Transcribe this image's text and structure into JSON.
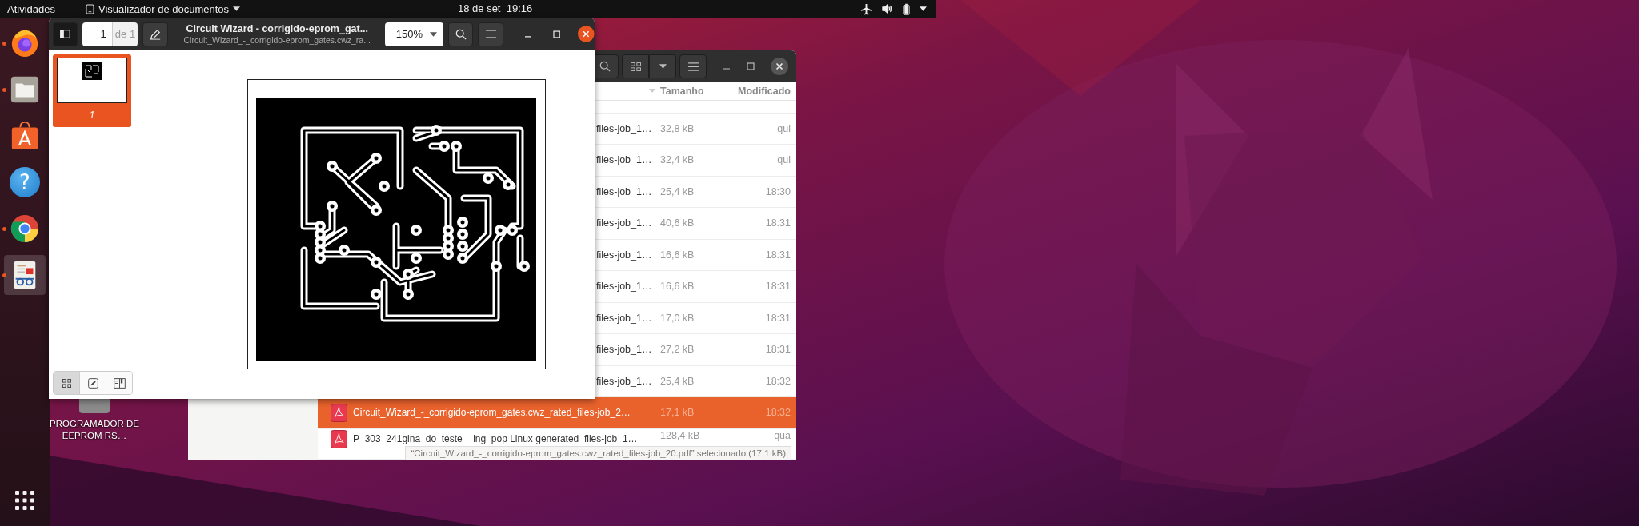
{
  "top_bar": {
    "activities": "Atividades",
    "app_menu": "Visualizador de documentos",
    "clock": "18 de set  19:16"
  },
  "dock": {
    "items": [
      {
        "kind": "firefox",
        "running": true,
        "selected": false
      },
      {
        "kind": "files",
        "running": true,
        "selected": false
      },
      {
        "kind": "software",
        "running": false,
        "selected": false
      },
      {
        "kind": "help",
        "running": false,
        "selected": false,
        "glyph": "?"
      },
      {
        "kind": "chrome",
        "running": true,
        "selected": false
      },
      {
        "kind": "viewer",
        "running": true,
        "selected": true
      }
    ]
  },
  "desktop_icons": [
    {
      "label": "PROGRAMADOR DE EEPROM RS…"
    }
  ],
  "document_viewer": {
    "page": "1",
    "page_total": "de 1",
    "title": "Circuit Wizard - corrigido-eprom_gat...",
    "subtitle": "Circuit_Wizard_-_corrigido-eprom_gates.cwz_ra...",
    "zoom": "150%",
    "thumbnails": [
      {
        "label": "1",
        "selected": true
      }
    ],
    "sidebar_tabs": [
      {
        "kind": "thumbnails",
        "selected": true
      },
      {
        "kind": "annotations",
        "selected": false
      },
      {
        "kind": "bookmarks",
        "selected": false
      }
    ]
  },
  "file_manager": {
    "columns": [
      "Tamanho",
      "Modificado"
    ],
    "rows": [
      {
        "kind": "covered",
        "name": "files-job_1…",
        "size": "32,8 kB",
        "modified": "qui",
        "selected": false
      },
      {
        "kind": "covered",
        "name": "files-job_1…",
        "size": "32,4 kB",
        "modified": "qui",
        "selected": false
      },
      {
        "kind": "covered",
        "name": "files-job_1…",
        "size": "25,4 kB",
        "modified": "18:30",
        "selected": false
      },
      {
        "kind": "covered",
        "name": "files-job_1…",
        "size": "40,6 kB",
        "modified": "18:31",
        "selected": false
      },
      {
        "kind": "covered",
        "name": "files-job_1…",
        "size": "16,6 kB",
        "modified": "18:31",
        "selected": false
      },
      {
        "kind": "covered",
        "name": "files-job_1…",
        "size": "16,6 kB",
        "modified": "18:31",
        "selected": false
      },
      {
        "kind": "covered",
        "name": "files-job_1…",
        "size": "17,0 kB",
        "modified": "18:31",
        "selected": false
      },
      {
        "kind": "covered",
        "name": "files-job_1…",
        "size": "27,2 kB",
        "modified": "18:31",
        "selected": false
      },
      {
        "kind": "covered",
        "name": "files-job_1…",
        "size": "25,4 kB",
        "modified": "18:32",
        "selected": false
      },
      {
        "kind": "pdf",
        "name": "Circuit_Wizard_-_corrigido-eprom_gates.cwz_rated_files-job_2…",
        "size": "17,1 kB",
        "modified": "18:32",
        "selected": true
      },
      {
        "kind": "pdf",
        "name": "P_303_241gina_do_teste__ing_pop Linux generated_files-job_1…",
        "size": "128,4 kB",
        "modified": "qua",
        "selected": false
      }
    ],
    "status": "“Circuit_Wizard_-_corrigido-eprom_gates.cwz_rated_files-job_20.pdf” selecionado  (17,1 kB)"
  }
}
